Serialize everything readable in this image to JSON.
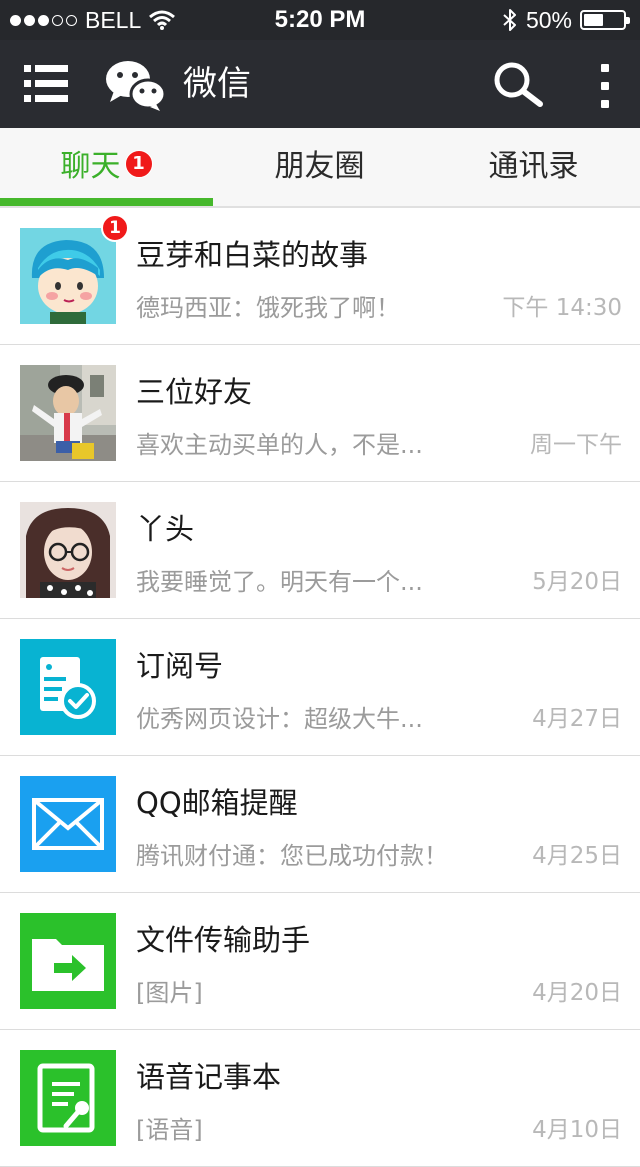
{
  "status_bar": {
    "signal_filled": 3,
    "signal_total": 5,
    "carrier": "BELL",
    "time": "5:20 PM",
    "battery_text": "50%",
    "battery_level": 0.5
  },
  "nav": {
    "title": "微信",
    "menu_icon": "list-menu-icon",
    "logo_icon": "wechat-logo-icon",
    "search_icon": "search-icon",
    "more_icon": "more-vertical-icon"
  },
  "tabs": [
    {
      "label": "聊天",
      "badge": "1",
      "active": true
    },
    {
      "label": "朋友圈",
      "active": false
    },
    {
      "label": "通讯录",
      "active": false
    }
  ],
  "colors": {
    "accent": "#46b82c",
    "badge": "#f01a1a",
    "header_bg": "#2a2c31"
  },
  "chats": [
    {
      "name": "豆芽和白菜的故事",
      "preview": "德玛西亚：饿死我了啊！",
      "time": "下午 14:30",
      "badge": "1",
      "avatar": "cartoon-boy-avatar"
    },
    {
      "name": "三位好友",
      "preview": "喜欢主动买单的人，不是...",
      "time": "周一下午",
      "avatar": "child-photo-avatar"
    },
    {
      "name": "丫头",
      "preview": "我要睡觉了。明天有一个...",
      "time": "5月20日",
      "avatar": "girl-glasses-avatar"
    },
    {
      "name": "订阅号",
      "preview": "优秀网页设计：超级大牛...",
      "time": "4月27日",
      "avatar": "subscription-icon"
    },
    {
      "name": "QQ邮箱提醒",
      "preview": "腾讯财付通：您已成功付款！",
      "time": "4月25日",
      "avatar": "mail-icon"
    },
    {
      "name": "文件传输助手",
      "preview": "[图片]",
      "time": "4月20日",
      "avatar": "file-transfer-icon"
    },
    {
      "name": "语音记事本",
      "preview": "[语音]",
      "time": "4月10日",
      "avatar": "voice-notepad-icon"
    }
  ]
}
